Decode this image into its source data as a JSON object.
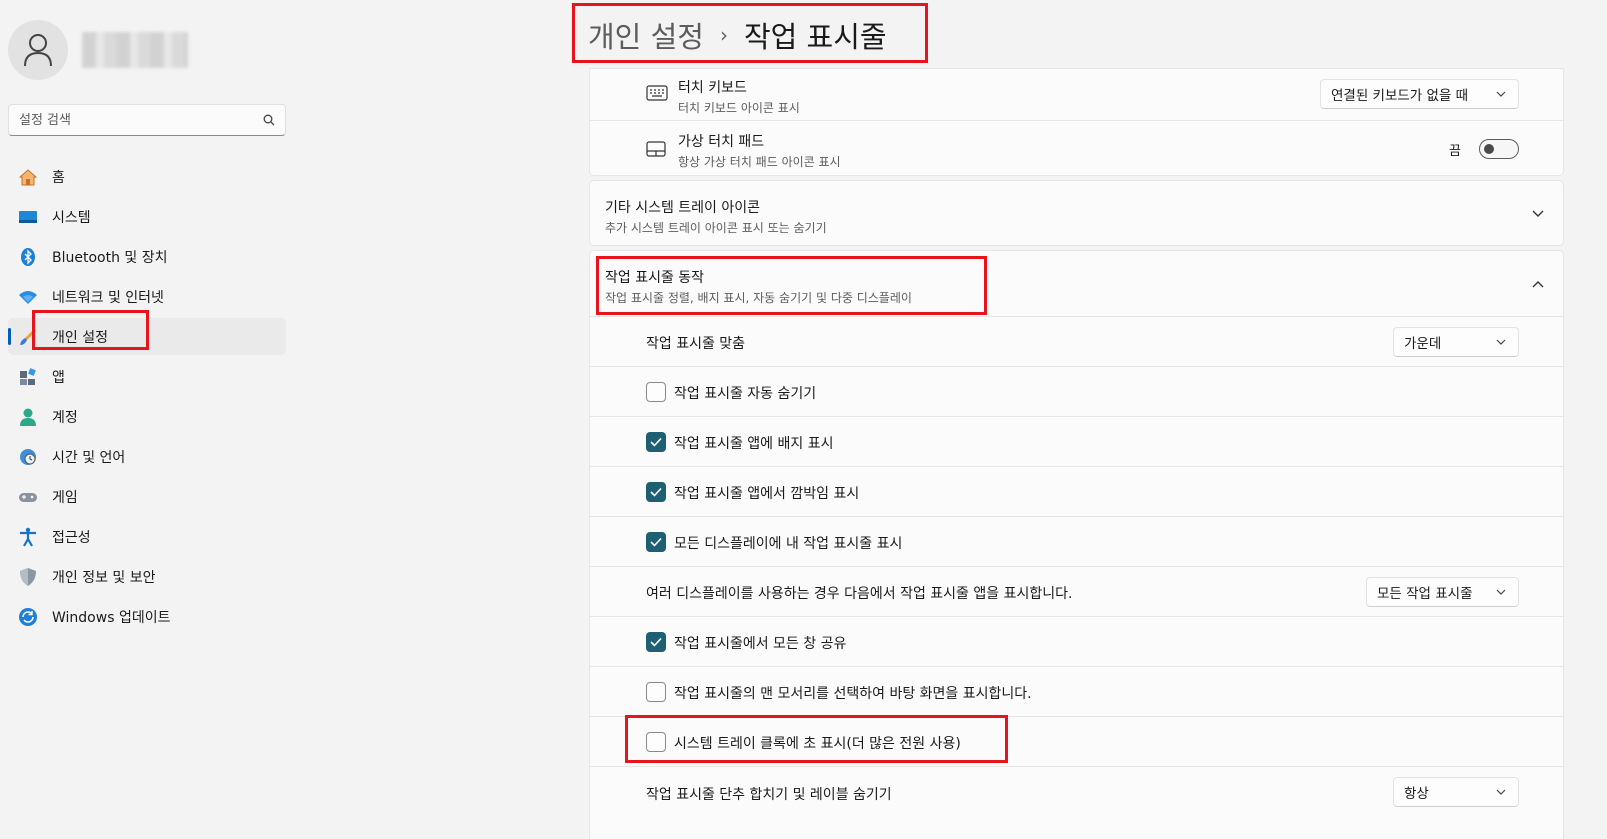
{
  "sidebar": {
    "search_placeholder": "설정 검색",
    "items": [
      {
        "label": "홈",
        "icon": "home-icon"
      },
      {
        "label": "시스템",
        "icon": "system-icon"
      },
      {
        "label": "Bluetooth 및 장치",
        "icon": "bluetooth-icon"
      },
      {
        "label": "네트워크 및 인터넷",
        "icon": "wifi-icon"
      },
      {
        "label": "개인 설정",
        "icon": "brush-icon",
        "active": true
      },
      {
        "label": "앱",
        "icon": "apps-icon"
      },
      {
        "label": "계정",
        "icon": "account-icon"
      },
      {
        "label": "시간 및 언어",
        "icon": "globe-clock-icon"
      },
      {
        "label": "게임",
        "icon": "gamepad-icon"
      },
      {
        "label": "접근성",
        "icon": "accessibility-icon"
      },
      {
        "label": "개인 정보 및 보안",
        "icon": "shield-icon"
      },
      {
        "label": "Windows 업데이트",
        "icon": "update-icon"
      }
    ]
  },
  "header": {
    "parent": "개인 설정",
    "separator": "›",
    "current": "작업 표시줄"
  },
  "pen_section": {
    "touch_keyboard": {
      "title": "터치 키보드",
      "subtitle": "터치 키보드 아이콘 표시",
      "dropdown_value": "연결된 키보드가 없을 때"
    },
    "virtual_touchpad": {
      "title": "가상 터치 패드",
      "subtitle": "항상 가상 터치 패드 아이콘 표시",
      "toggle_label": "끔",
      "toggle_on": false
    }
  },
  "other_tray": {
    "title": "기타 시스템 트레이 아이콘",
    "subtitle": "추가 시스템 트레이 아이콘 표시 또는 숨기기"
  },
  "behaviors": {
    "title": "작업 표시줄 동작",
    "subtitle": "작업 표시줄 정렬, 배지 표시, 자동 숨기기 및 다중 디스플레이",
    "alignment_label": "작업 표시줄 맞춤",
    "alignment_value": "가운데",
    "auto_hide": {
      "label": "작업 표시줄 자동 숨기기",
      "checked": false
    },
    "badges": {
      "label": "작업 표시줄 앱에 배지 표시",
      "checked": true
    },
    "flashing": {
      "label": "작업 표시줄 앱에서 깜박임 표시",
      "checked": true
    },
    "all_displays": {
      "label": "모든 디스플레이에 내 작업 표시줄 표시",
      "checked": true
    },
    "multi_display_label": "여러 디스플레이를 사용하는 경우 다음에서 작업 표시줄 앱을 표시합니다.",
    "multi_display_value": "모든 작업 표시줄",
    "share_windows": {
      "label": "작업 표시줄에서 모든 창 공유",
      "checked": true
    },
    "show_desktop": {
      "label": "작업 표시줄의 맨 모서리를 선택하여 바탕 화면을 표시합니다.",
      "checked": false
    },
    "seconds_clock": {
      "label": "시스템 트레이 클록에 초 표시(더 많은 전원 사용)",
      "checked": false
    },
    "combine_label": "작업 표시줄 단추 합치기 및 레이블 숨기기",
    "combine_value": "항상"
  },
  "colors": {
    "accent": "#005fb8",
    "checkbox_checked": "#1f5f74",
    "annotation": "#e8141b"
  }
}
